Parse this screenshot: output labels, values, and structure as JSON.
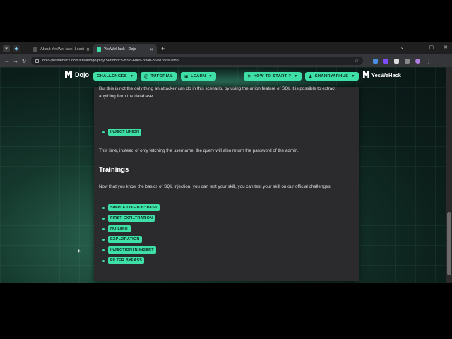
{
  "browser": {
    "tabs": [
      {
        "title": "About YesWeHack: Leading Bu",
        "active": false
      },
      {
        "title": "YesWeHack - Dojo",
        "active": true
      }
    ],
    "url": "dojo-yeswehack.com/challenge/play/5e6db8c3-d3fc-4dea-bbab-36e876d606b8"
  },
  "site": {
    "logo": "Dojo",
    "nav": {
      "challenges": "CHALLENGES",
      "tutorial": "TUTORIAL",
      "learn": "LEARN",
      "how_to_start": "HOW TO START ?",
      "user": "SHAHRYARHUS"
    },
    "brand": "YesWeHack"
  },
  "content": {
    "para1": "But this is not the only thing an attacker can do in this scenario, by using the union feature of SQL it is possible to extract anything from the database.",
    "union_chip": "INJECT UNION",
    "para2": "This time, instead of only fetching the username, the query will also return the password of the admin.",
    "trainings_heading": "Trainings",
    "para3": "Now that you know the basics of SQL injection, you can test your skill, you can test your skill on our official challenges:",
    "challenges": [
      "SIMPLE LOGIN BYPASS",
      "FIRST EXFILTRATION",
      "NO LIMIT",
      "EXPLORATION",
      "INJECTION IN INSERT",
      "FILTER BYPASS"
    ]
  },
  "colors": {
    "accent": "#3fe0a8",
    "card": "#2b2b2e"
  }
}
